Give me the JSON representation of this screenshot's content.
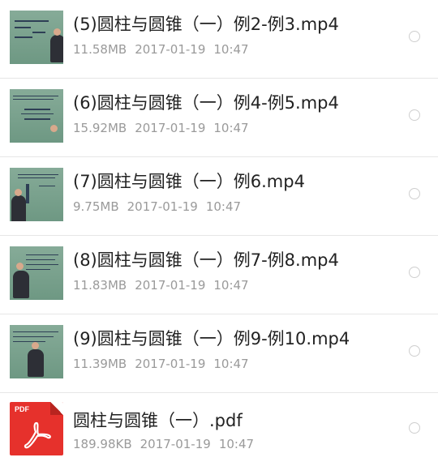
{
  "files": [
    {
      "name": "(5)圆柱与圆锥（一）例2-例3.mp4",
      "size": "11.58MB",
      "date": "2017-01-19",
      "time": "10:47",
      "icon": "video-thumbnail-icon"
    },
    {
      "name": "(6)圆柱与圆锥（一）例4-例5.mp4",
      "size": "15.92MB",
      "date": "2017-01-19",
      "time": "10:47",
      "icon": "video-thumbnail-icon"
    },
    {
      "name": "(7)圆柱与圆锥（一）例6.mp4",
      "size": "9.75MB",
      "date": "2017-01-19",
      "time": "10:47",
      "icon": "video-thumbnail-icon"
    },
    {
      "name": "(8)圆柱与圆锥（一）例7-例8.mp4",
      "size": "11.83MB",
      "date": "2017-01-19",
      "time": "10:47",
      "icon": "video-thumbnail-icon"
    },
    {
      "name": "(9)圆柱与圆锥（一）例9-例10.mp4",
      "size": "11.39MB",
      "date": "2017-01-19",
      "time": "10:47",
      "icon": "video-thumbnail-icon"
    },
    {
      "name": "圆柱与圆锥（一）.pdf",
      "size": "189.98KB",
      "date": "2017-01-19",
      "time": "10:47",
      "icon": "pdf-file-icon"
    }
  ],
  "pdf_badge": "PDF",
  "colors": {
    "pdf_red": "#e6312c",
    "meta_gray": "#9a9a9a",
    "title_dark": "#222222"
  }
}
